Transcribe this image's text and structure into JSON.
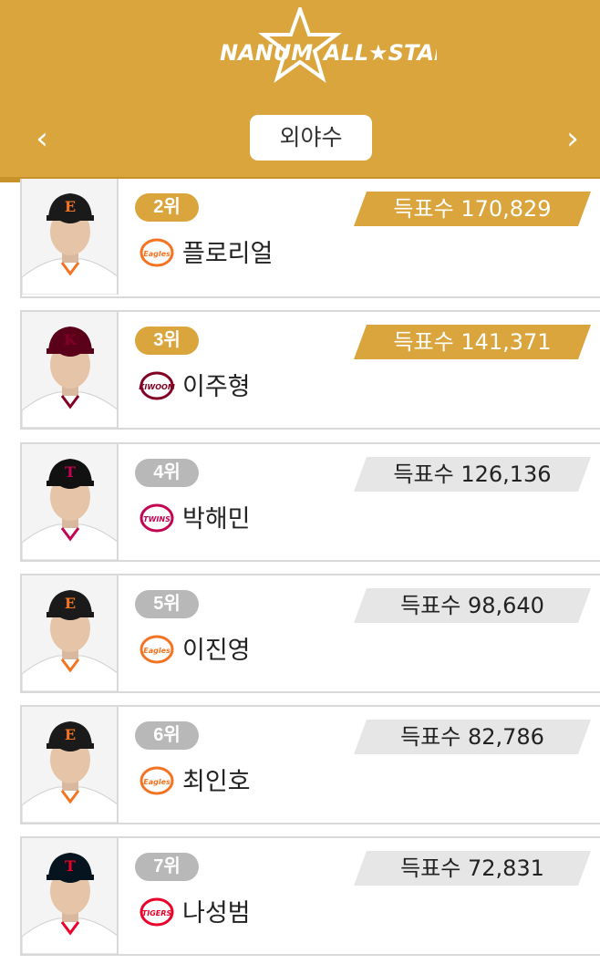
{
  "header": {
    "logo_left": "NANUM",
    "logo_right": "ALL★STAR",
    "category": "외야수",
    "prev_icon": "chevron-left-icon",
    "next_icon": "chevron-right-icon",
    "prev_glyph": "‹",
    "next_glyph": "›",
    "brand_color": "#d9a53c"
  },
  "players": [
    {
      "rank": "2위",
      "name": "플로리얼",
      "votes_label": "득표수",
      "votes": "170,829",
      "team_logo": "eagles-logo",
      "team_text": "Eagles",
      "highlight": "gold"
    },
    {
      "rank": "3위",
      "name": "이주형",
      "votes_label": "득표수",
      "votes": "141,371",
      "team_logo": "kiwoom-logo",
      "team_text": "KIWOOM",
      "highlight": "gold"
    },
    {
      "rank": "4위",
      "name": "박해민",
      "votes_label": "득표수",
      "votes": "126,136",
      "team_logo": "twins-logo",
      "team_text": "TWINS",
      "highlight": "gray"
    },
    {
      "rank": "5위",
      "name": "이진영",
      "votes_label": "득표수",
      "votes": "98,640",
      "team_logo": "eagles-logo",
      "team_text": "Eagles",
      "highlight": "gray"
    },
    {
      "rank": "6위",
      "name": "최인호",
      "votes_label": "득표수",
      "votes": "82,786",
      "team_logo": "eagles-logo",
      "team_text": "Eagles",
      "highlight": "gray"
    },
    {
      "rank": "7위",
      "name": "나성범",
      "votes_label": "득표수",
      "votes": "72,831",
      "team_logo": "tigers-logo",
      "team_text": "TIGERS",
      "highlight": "gray"
    }
  ]
}
